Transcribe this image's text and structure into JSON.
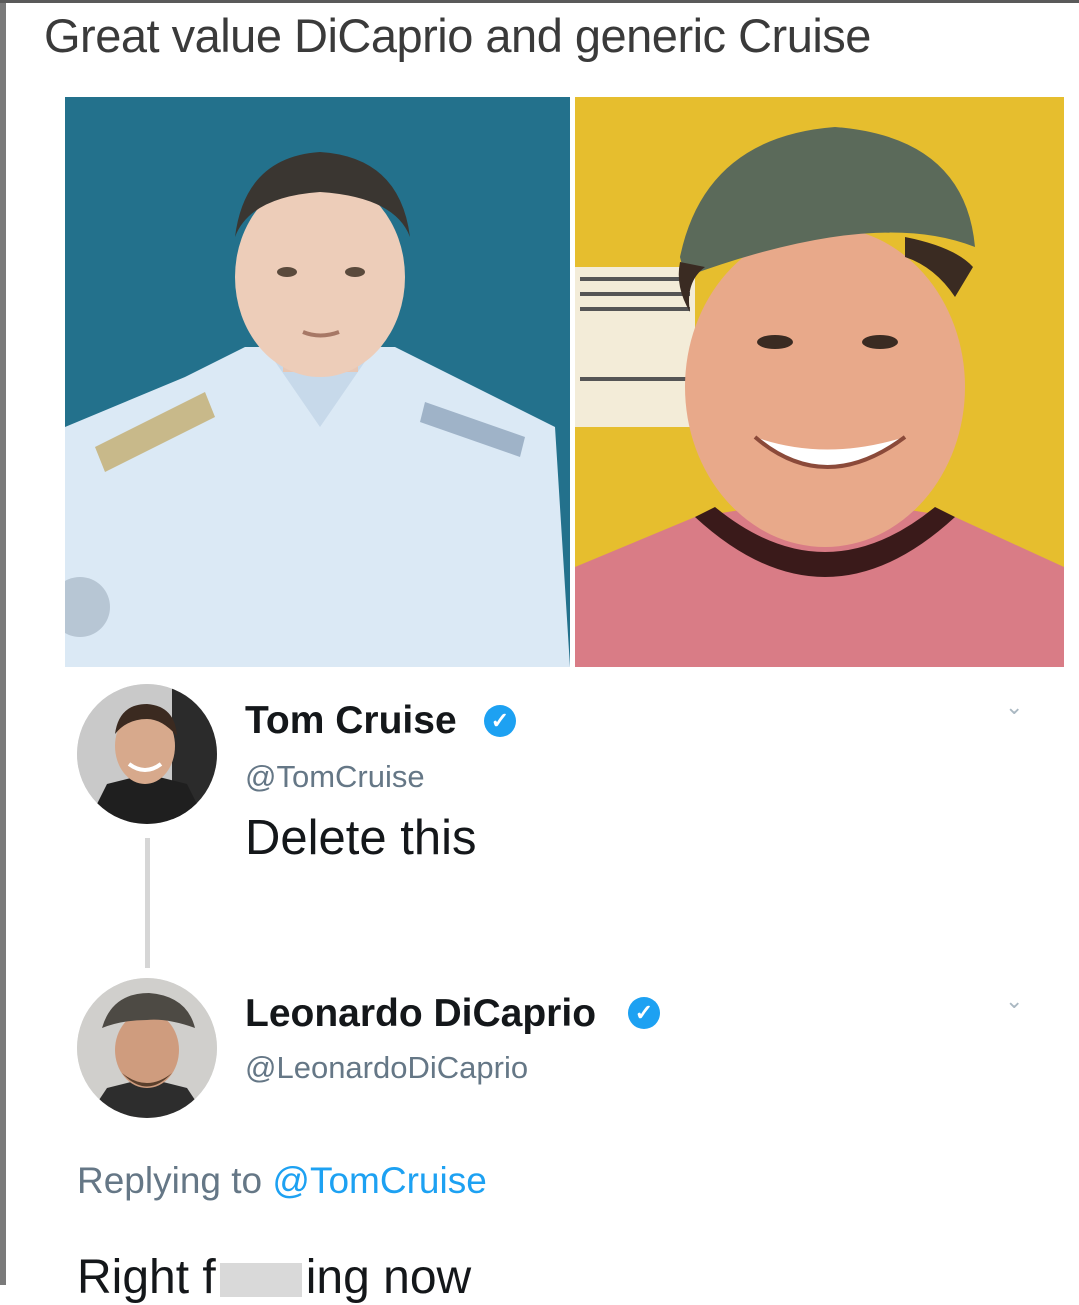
{
  "caption": "Great value DiCaprio and generic Cruise",
  "photos": {
    "left": {
      "icon": "man-in-uniform-photo",
      "colors": {
        "background": "#1f6c88",
        "shirt": "#dbe9f5"
      }
    },
    "right": {
      "icon": "man-in-cap-photo",
      "colors": {
        "background": "#e6be2e",
        "shirt": "#d97c86"
      }
    }
  },
  "tweets": [
    {
      "name": "Tom Cruise",
      "handle": "@TomCruise",
      "verified": true,
      "text": "Delete this"
    },
    {
      "name": "Leonardo DiCaprio",
      "handle": "@LeonardoDiCaprio",
      "verified": true,
      "replying_prefix": "Replying to ",
      "replying_mention": "@TomCruise",
      "text_start": "Right f",
      "text_end": "ing now"
    }
  ],
  "colors": {
    "link": "#1da1f2",
    "verified": "#1da1f2",
    "muted": "#657786"
  }
}
